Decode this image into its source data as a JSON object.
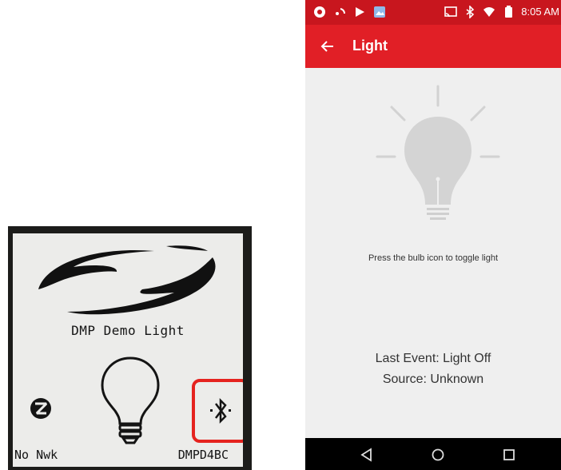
{
  "lcd": {
    "title": "DMP Demo Light",
    "network_status": "No Nwk",
    "device_id": "DMPD4BC",
    "icons": [
      "silicon-labs-logo",
      "bulb-icon",
      "zigbee-icon",
      "bluetooth-icon"
    ],
    "highlight_color": "#e5231f"
  },
  "phone": {
    "status_bar": {
      "time": "8:05 AM",
      "icons_left": [
        "chrome-icon",
        "wifi-dots-icon",
        "play-store-icon",
        "image-icon"
      ],
      "icons_right": [
        "cast-icon",
        "bluetooth-icon",
        "wifi-icon",
        "battery-icon"
      ]
    },
    "app_bar": {
      "title": "Light",
      "back_icon": "arrow-left-icon",
      "color": "#e11f26"
    },
    "hint_text": "Press the bulb icon to toggle light",
    "last_event": "Last Event: Light Off",
    "source": "Source: Unknown",
    "nav": [
      "back-icon",
      "home-icon",
      "recents-icon"
    ]
  }
}
